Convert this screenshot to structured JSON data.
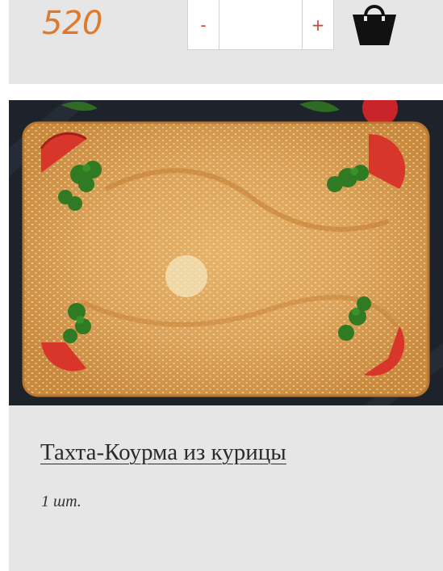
{
  "product_top": {
    "price": "520",
    "qty_minus_label": "-",
    "qty_plus_label": "+",
    "qty_value": "",
    "cart_icon": "shopping-bag-icon",
    "accent_color": "#e07a2a"
  },
  "product": {
    "image_icon": "product-photo-pie",
    "title": "Тахта-Коурма из курицы",
    "unit": "1 шт."
  }
}
